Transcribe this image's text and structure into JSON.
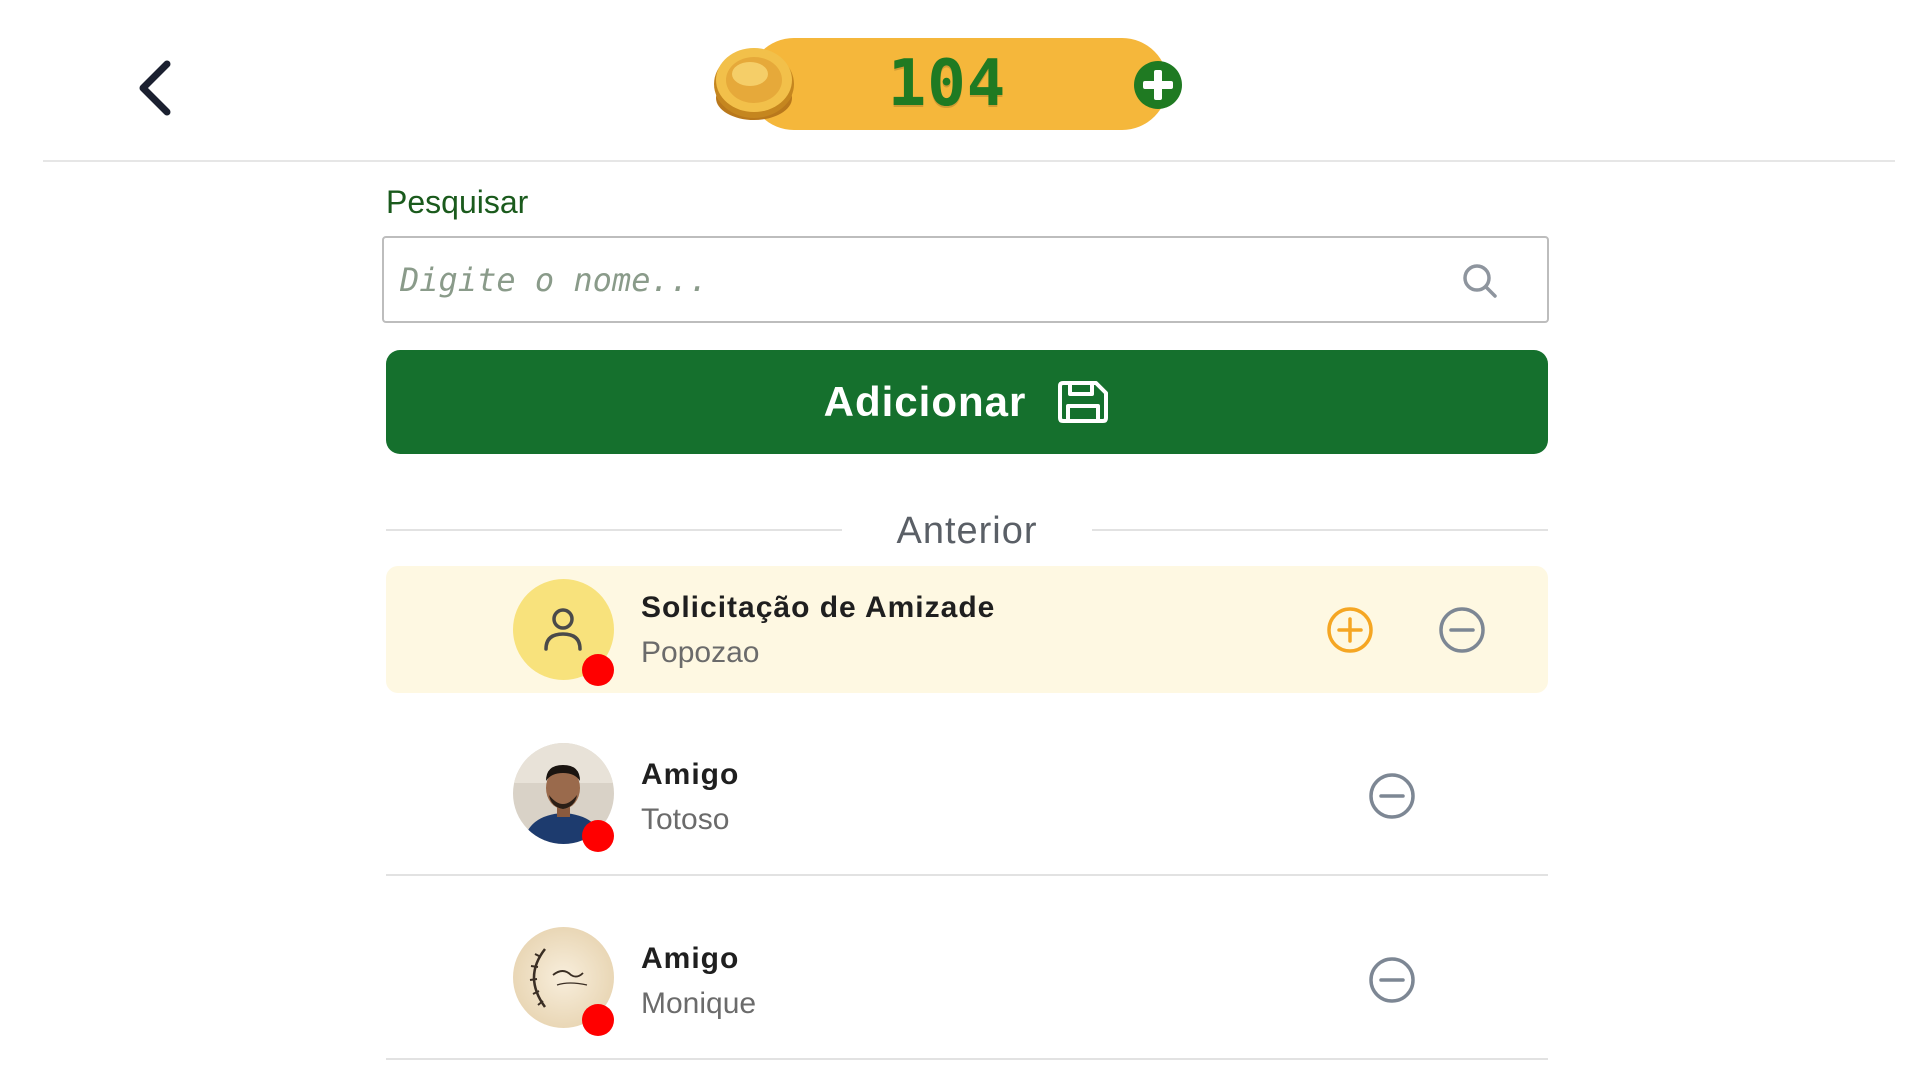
{
  "header": {
    "back_icon": "chevron-left-icon",
    "coins": {
      "count": "104",
      "coin_icon": "gold-coin-icon",
      "add_icon": "plus-circle-icon",
      "pill_color": "#f5b73b",
      "count_color": "#1f7a22"
    }
  },
  "search": {
    "label": "Pesquisar",
    "placeholder": "Digite o nome...",
    "value": "",
    "icon": "search-icon"
  },
  "add_button": {
    "label": "Adicionar",
    "icon": "save-icon",
    "color": "#15702d"
  },
  "section": {
    "title": "Anterior"
  },
  "rows": [
    {
      "title": "Solicitação de Amizade",
      "subtitle": "Popozao",
      "avatar_icon": "user-icon",
      "status_color": "#ff0000",
      "actions": [
        "accept",
        "decline"
      ],
      "background": "#fef8e2"
    },
    {
      "title": "Amigo",
      "subtitle": "Totoso",
      "avatar_icon": "profile-photo",
      "status_color": "#ff0000",
      "actions": [
        "remove"
      ]
    },
    {
      "title": "Amigo",
      "subtitle": "Monique",
      "avatar_icon": "profile-photo-logo",
      "status_color": "#ff0000",
      "actions": [
        "remove"
      ]
    }
  ],
  "colors": {
    "accept_icon": "#f5a623",
    "decline_icon": "#7d8794",
    "status_dot": "#ff0000"
  }
}
